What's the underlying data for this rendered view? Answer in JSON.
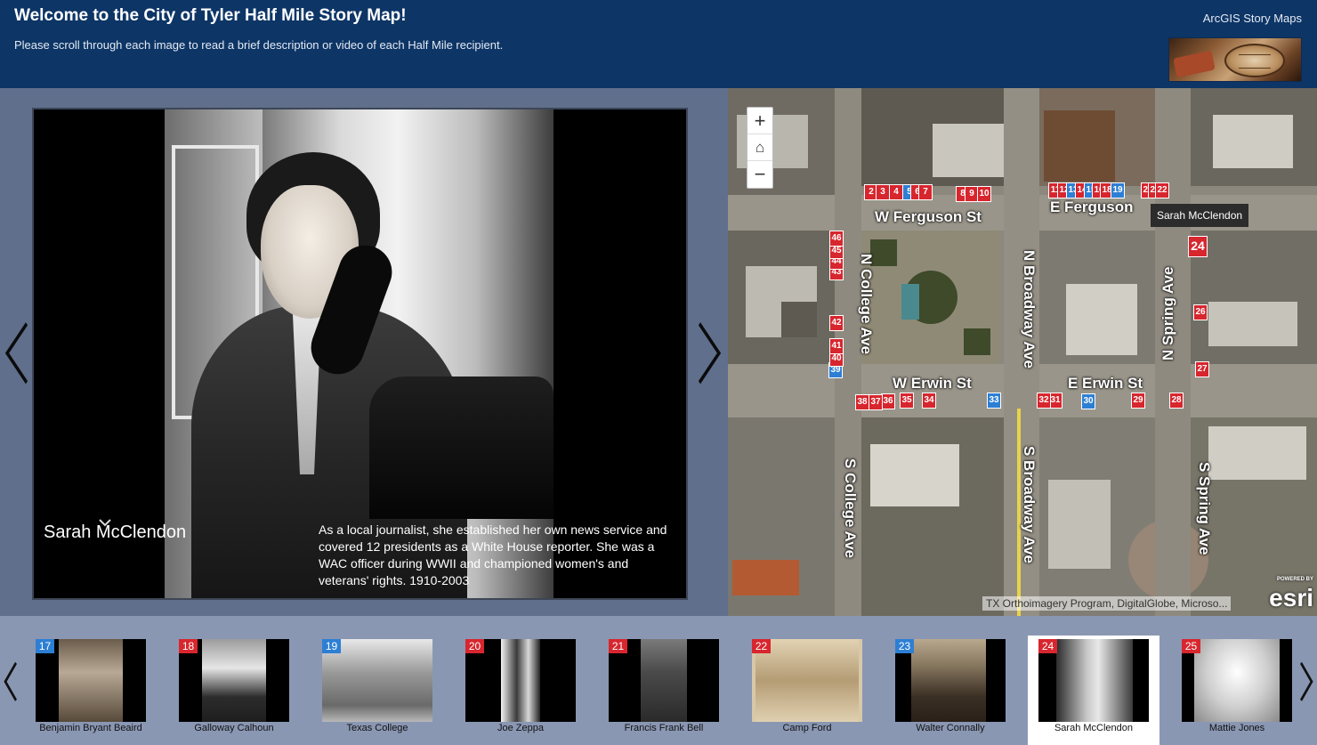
{
  "header": {
    "title": "Welcome to the City of Tyler Half Mile Story Map!",
    "subtitle": "Please scroll through each image to read a brief description or video of each Half Mile recipient.",
    "brand": "ArcGIS Story Maps"
  },
  "media": {
    "item_title": "Sarah McClendon",
    "item_description": "As a local journalist, she established her own news service and covered 12 presidents as a White House reporter. She was a WAC officer during WWII and championed women's and veterans' rights. 1910-2003",
    "prev_icon": "chevron-left-icon",
    "next_icon": "chevron-right-icon",
    "collapse_icon": "chevron-down-icon"
  },
  "map": {
    "zoom_in": "+",
    "home": "⌂",
    "zoom_out": "−",
    "streets": {
      "w_ferguson": "W Ferguson St",
      "e_ferguson": "E Ferguson",
      "w_erwin": "W Erwin St",
      "e_erwin": "E Erwin St",
      "n_college": "N College Ave",
      "s_college": "S College Ave",
      "n_broadway": "N Broadway Ave",
      "s_broadway": "S Broadway Ave",
      "n_spring": "N Spring Ave",
      "s_spring": "S Spring Ave"
    },
    "tooltip": "Sarah McClendon",
    "attribution": "TX Orthoimagery Program, DigitalGlobe, Microso...",
    "esri_powered": "POWERED BY",
    "esri_logo": "esri",
    "markers": {
      "m2": "2",
      "m3": "3",
      "m4": "4",
      "m5": "5",
      "m6": "6",
      "m7": "7",
      "m8": "8",
      "m9": "9",
      "m10": "10",
      "m11": "11",
      "m12": "12",
      "m13": "13",
      "m14": "14",
      "m15": "15",
      "m16": "16",
      "m18": "18",
      "m19": "19",
      "m20": "20",
      "m21": "21",
      "m22": "22",
      "m24": "24",
      "m26": "26",
      "m27": "27",
      "m28": "28",
      "m29": "29",
      "m30": "30",
      "m31": "31",
      "m32": "32",
      "m33": "33",
      "m34": "34",
      "m35": "35",
      "m36": "36",
      "m37": "37",
      "m38": "38",
      "m39": "39",
      "m40": "40",
      "m41": "41",
      "m42": "42",
      "m43": "43",
      "m44": "44",
      "m45": "45",
      "m46": "46"
    },
    "colors": {
      "red_marker": "#d7262e",
      "blue_marker": "#2d7fd4"
    }
  },
  "carousel": {
    "items": [
      {
        "number": "17",
        "label": "Benjamin Bryant Beaird",
        "color": "blue"
      },
      {
        "number": "18",
        "label": "Galloway Calhoun",
        "color": "red"
      },
      {
        "number": "19",
        "label": "Texas College",
        "color": "blue"
      },
      {
        "number": "20",
        "label": "Joe Zeppa",
        "color": "red"
      },
      {
        "number": "21",
        "label": "Francis Frank Bell",
        "color": "red"
      },
      {
        "number": "22",
        "label": "Camp Ford",
        "color": "red"
      },
      {
        "number": "23",
        "label": "Walter Connally",
        "color": "blue"
      },
      {
        "number": "24",
        "label": "Sarah McClendon",
        "color": "red"
      },
      {
        "number": "25",
        "label": "Mattie Jones",
        "color": "red"
      }
    ],
    "active_index": 7
  }
}
